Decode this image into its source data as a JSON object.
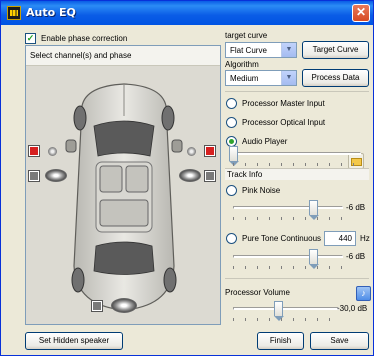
{
  "window": {
    "title": "Auto EQ",
    "close": "✕"
  },
  "phase": {
    "checked": true,
    "label": "Enable phase correction",
    "check": "✓"
  },
  "channels": {
    "header": "Select channel(s) and phase"
  },
  "target_curve": {
    "label": "target curve",
    "selected": "Flat Curve",
    "button": "Target Curve"
  },
  "algorithm": {
    "label": "Algorithm",
    "selected": "Medium",
    "button": "Process Data"
  },
  "inputs": [
    {
      "label": "Processor Master Input",
      "selected": false
    },
    {
      "label": "Processor Optical Input",
      "selected": false
    },
    {
      "label": "Audio Player",
      "selected": true
    }
  ],
  "track_info": {
    "label": "Track Info"
  },
  "pink_noise": {
    "label": "Pink Noise",
    "value": "-6 dB",
    "level": 0.73
  },
  "pure_tone": {
    "label": "Pure Tone Continuous",
    "freq": "440",
    "unit": "Hz",
    "value": "-6 dB",
    "level": 0.73
  },
  "audio_player_position": 0.0,
  "processor_volume": {
    "label": "Processor Volume",
    "value": "-30,0 dB",
    "level": 0.42
  },
  "buttons": {
    "hidden_speaker": "Set Hidden speaker",
    "finish": "Finish",
    "save": "Save"
  },
  "icons": {
    "folder": "folder-open-icon",
    "volume": "speaker-volume-icon",
    "arrow": "▼"
  },
  "colors": {
    "titlebar": "#0a5ce6",
    "close": "#d74a23",
    "radio_selected": "#2fa32f",
    "speaker_red": "#d62020"
  }
}
